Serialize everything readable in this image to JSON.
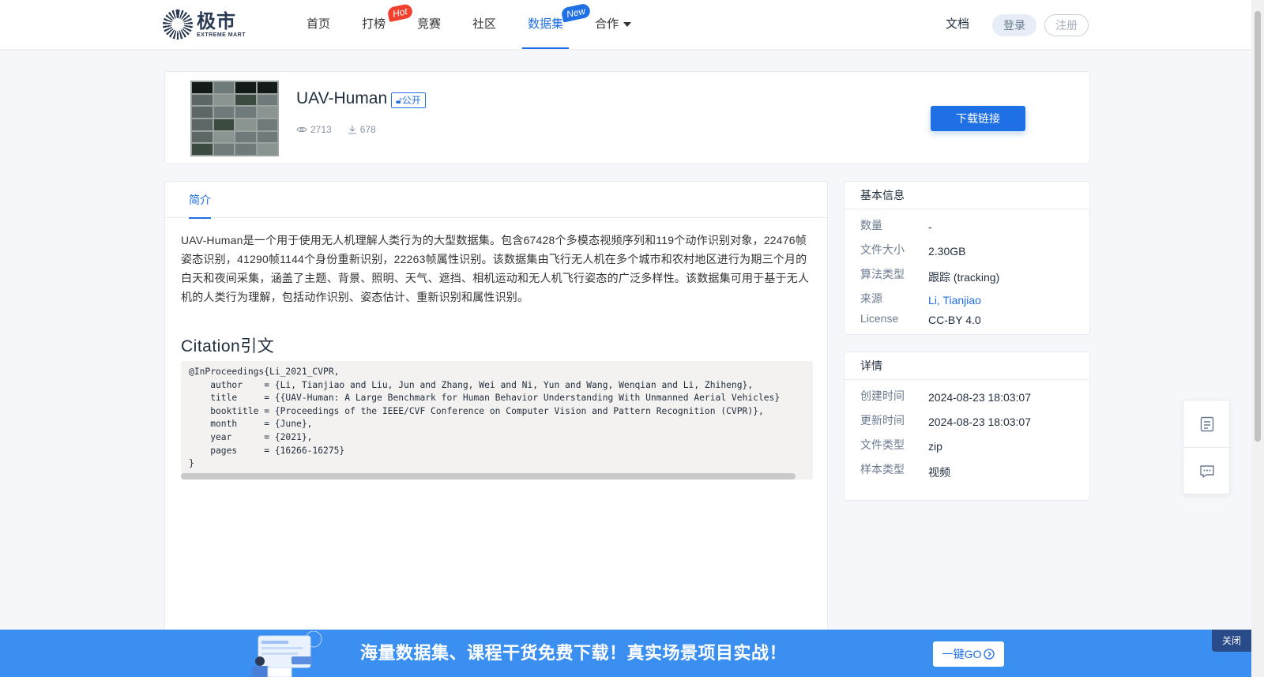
{
  "header": {
    "logo_cn": "极市",
    "logo_en": "EXTREME MART",
    "nav": [
      {
        "label": "首页"
      },
      {
        "label": "打榜",
        "badge": "Hot"
      },
      {
        "label": "竞赛"
      },
      {
        "label": "社区"
      },
      {
        "label": "数据集",
        "badge": "New",
        "active": true
      },
      {
        "label": "合作"
      }
    ],
    "doc_label": "文档",
    "login_label": "登录",
    "register_label": "注册"
  },
  "dataset": {
    "title": "UAV-Human",
    "visibility": "公开",
    "views": "2713",
    "downloads": "678",
    "download_button": "下载链接"
  },
  "content": {
    "tab": "简介",
    "intro": "UAV-Human是一个用于使用无人机理解人类行为的大型数据集。包含67428个多模态视频序列和119个动作识别对象，22476帧姿态识别，41290帧1144个身份重新识别，22263帧属性识别。该数据集由飞行无人机在多个城市和农村地区进行为期三个月的白天和夜间采集，涵盖了主题、背景、照明、天气、遮挡、相机运动和无人机飞行姿态的广泛多样性。该数据集可用于基于无人机的人类行为理解，包括动作识别、姿态估计、重新识别和属性识别。",
    "citation_title": "Citation引文",
    "citation_code": "@InProceedings{Li_2021_CVPR,\n    author    = {Li, Tianjiao and Liu, Jun and Zhang, Wei and Ni, Yun and Wang, Wenqian and Li, Zhiheng},\n    title     = {{UAV-Human: A Large Benchmark for Human Behavior Understanding With Unmanned Aerial Vehicles}\n    booktitle = {Proceedings of the IEEE/CVF Conference on Computer Vision and Pattern Recognition (CVPR)},\n    month     = {June},\n    year      = {2021},\n    pages     = {16266-16275}\n}"
  },
  "basic_info": {
    "title": "基本信息",
    "rows": [
      {
        "label": "数量",
        "value": "-"
      },
      {
        "label": "文件大小",
        "value": "2.30GB"
      },
      {
        "label": "算法类型",
        "value": "跟踪 (tracking)"
      },
      {
        "label": "来源",
        "value": "Li, Tianjiao"
      },
      {
        "label": "License",
        "value": "CC-BY 4.0"
      }
    ]
  },
  "details": {
    "title": "详情",
    "rows": [
      {
        "label": "创建时间",
        "value": "2024-08-23 18:03:07"
      },
      {
        "label": "更新时间",
        "value": "2024-08-23 18:03:07"
      },
      {
        "label": "文件类型",
        "value": "zip"
      },
      {
        "label": "样本类型",
        "value": "视频"
      }
    ]
  },
  "banner": {
    "text": "海量数据集、课程干货免费下载！真实场景项目实战！",
    "go_button": "一键GO",
    "close_button": "关闭"
  },
  "colors": {
    "accent": "#1f6fe5",
    "hot_badge": "#f2412f",
    "banner_bg": "#3a8ff0"
  }
}
